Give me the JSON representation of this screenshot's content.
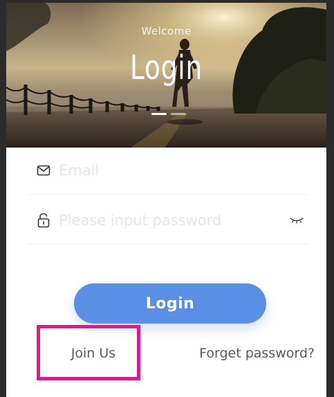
{
  "hero": {
    "welcome": "Welcome",
    "title": "Login"
  },
  "form": {
    "email": {
      "icon": "envelope-icon",
      "placeholder": "Email",
      "value": ""
    },
    "password": {
      "icon": "lock-icon",
      "placeholder": "Please input password",
      "value": "",
      "toggle_icon": "eye-closed-icon"
    }
  },
  "actions": {
    "login_label": "Login",
    "join_label": "Join Us",
    "forget_label": "Forget password?"
  },
  "colors": {
    "primary": "#5b8fe6",
    "highlight": "#e6168c",
    "link_text": "#555b66",
    "placeholder": "#e4e6ea"
  }
}
